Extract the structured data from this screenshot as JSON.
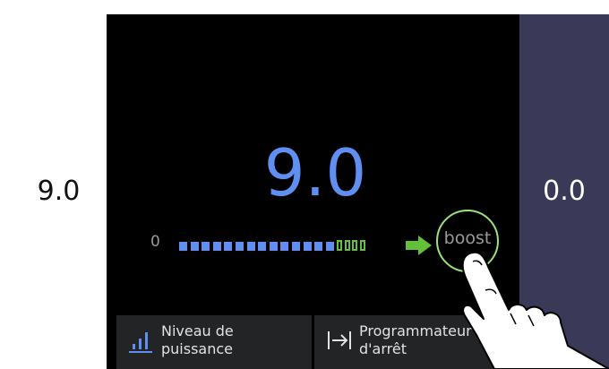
{
  "left_zone": {
    "value": "9.0"
  },
  "right_zone": {
    "value": "0.0"
  },
  "main": {
    "power_value": "9.0",
    "slider_min": "0",
    "boost_label": "boost",
    "slider_level_fraction": 0.9
  },
  "tabs": [
    {
      "label": "Niveau de\npuissance",
      "icon": "power-level-icon"
    },
    {
      "label": "Programmateur\nd'arrêt",
      "icon": "timer-stop-icon"
    }
  ],
  "colors": {
    "accent_blue": "#5f8ff0",
    "boost_green": "#62c13a",
    "right_zone": "#3a3a58",
    "tab_bg": "#222426"
  }
}
